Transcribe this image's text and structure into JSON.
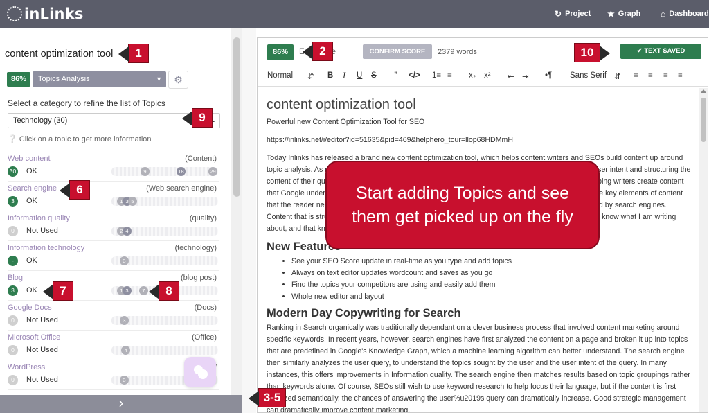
{
  "app": {
    "logo_text": "inLinks"
  },
  "nav": [
    {
      "icon": "refresh-icon",
      "label": "Project"
    },
    {
      "icon": "star-icon",
      "label": "Graph"
    },
    {
      "icon": "home-icon",
      "label": "Dashboard"
    }
  ],
  "left": {
    "keyword": "content optimization tool",
    "score": "86%",
    "analysis_select": "Topics Analysis",
    "category_label": "Select a category to refine the list of Topics",
    "category_value": "Technology (30)",
    "hint": "Click on a topic to get more information",
    "topics": [
      {
        "name": "Web content",
        "type": "(Content)",
        "count": "30",
        "status": "OK",
        "count_style": "green",
        "dots": [
          "9",
          "18",
          "29"
        ]
      },
      {
        "name": "Search engine",
        "type": "(Web search engine)",
        "count": "3",
        "status": "OK",
        "count_style": "green",
        "dots": [
          "1",
          "3",
          "5"
        ]
      },
      {
        "name": "Information quality",
        "type": "(quality)",
        "count": "0",
        "status": "Not Used",
        "count_style": "grey",
        "dots": [
          "2",
          "4"
        ]
      },
      {
        "name": "Information technology",
        "type": "(technology)",
        "count": "-",
        "status": "OK",
        "count_style": "green",
        "dots": [
          "3"
        ]
      },
      {
        "name": "Blog",
        "type": "(blog post)",
        "count": "3",
        "status": "OK",
        "count_style": "green",
        "dots": [
          "1",
          "3",
          "7"
        ]
      },
      {
        "name": "Google Docs",
        "type": "(Docs)",
        "count": "0",
        "status": "Not Used",
        "count_style": "grey",
        "dots": [
          "3"
        ]
      },
      {
        "name": "Microsoft Office",
        "type": "(Office)",
        "count": "0",
        "status": "Not Used",
        "count_style": "grey",
        "dots": [
          "4"
        ]
      },
      {
        "name": "WordPress",
        "type": "(W",
        "count": "0",
        "status": "Not Used",
        "count_style": "grey",
        "dots": [
          "3"
        ]
      }
    ],
    "footer_icon": "chevron-right-icon"
  },
  "editor": {
    "score": "86%",
    "score_label": "Edit Score",
    "confirm_label": "CONFIRM SCORE",
    "word_count": "2379 words",
    "saved_label": "✔ TEXT SAVED",
    "toolbar": {
      "format": "Normal",
      "font": "Sans Serif",
      "buttons": [
        "B",
        "I",
        "U",
        "S",
        "”",
        "</>",
        "1≡",
        "≡",
        "x₂",
        "x²",
        "⇤",
        "⇥",
        "•¶"
      ]
    },
    "title": "content optimization tool",
    "p1": "Powerful new Content Optimization Tool for SEO",
    "p2": "https://inlinks.net/i/editor?id=51635&pid=469&helphero_tour=llop68HDMmH",
    "p3": "Today Inlinks has released a brand new content optimization tool, which helps content writers and SEOs build content up around topic analysis. As modern Search engines have moved from keyword matching to understanding the user intent and structuring the content of their questions, so traditional keyword-based optimization is no longer enough. Inlinks is helping writers create content that Google understands topics first and foremost, before the words. This lets writers concentrate on the key elements of content that the reader needs, be creative, whilst addressing user intent and so satisfying the topic models used by search engines. Content that is structured this way is readily understood by Google and other search engines. I need to know what I am writing about, and that knowledge is now being passed to the search engines with more accuracy than before.",
    "h2_features": "New Features",
    "features": [
      "See your SEO Score update in real-time as you type and add topics",
      "Always on text editor updates wordcount and saves as you go",
      "Find the topics your competitors are using and easily add them",
      "Whole new editor and layout"
    ],
    "h2_modern": "Modern Day Copywriting for Search",
    "p4": "Ranking in Search organically was traditionally dependant on a clever business process that involved content marketing around specific keywords. In recent years, however, search engines have first analyzed the content on a page and broken it up into topics that are predefined in Google's Knowledge Graph, which a machine learning algorithm can better understand. The search engine then similarly analyzes the user query, to understand the topics sought by the user and the user intent of the query. In many instances, this offers improvements in Information quality. The search engine then matches results based on topic groupings rather than keywords alone. Of course, SEOs still wish to use keyword research to help focus their language, but if the content is first analyzed semantically, the chances of answering the user%u2019s query can dramatically increase. Good strategic management can dramatically improve content marketing."
  },
  "overlay": {
    "text": "Start adding Topics and see them get picked up on the fly"
  },
  "callouts": [
    "1",
    "2",
    "3-5",
    "6",
    "7",
    "8",
    "9",
    "10"
  ]
}
